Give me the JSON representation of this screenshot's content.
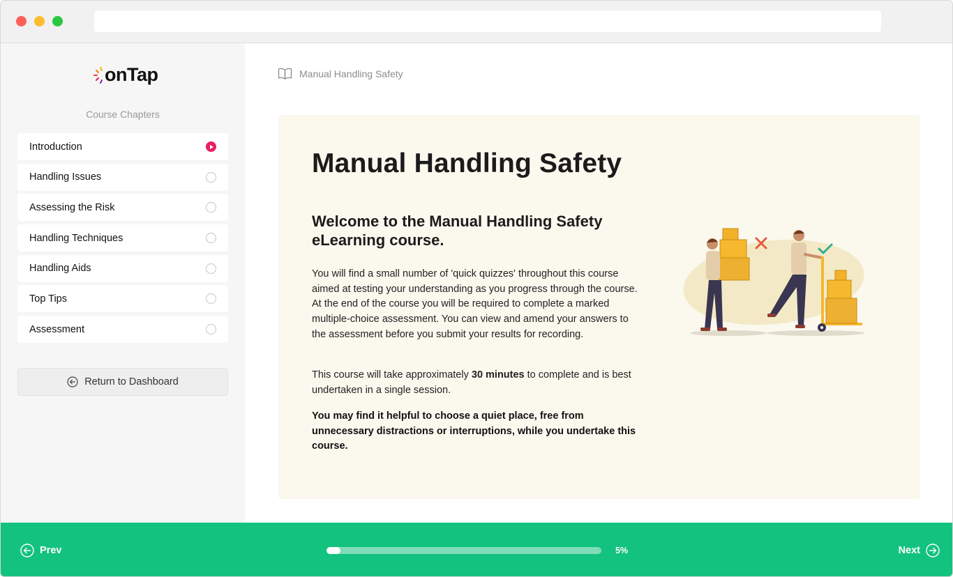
{
  "window": {
    "controls": [
      "close",
      "minimize",
      "maximize"
    ],
    "url": ""
  },
  "sidebar": {
    "logo_text": "onTap",
    "chapters_title": "Course Chapters",
    "chapters": [
      {
        "label": "Introduction",
        "status": "current"
      },
      {
        "label": "Handling Issues",
        "status": "not-started"
      },
      {
        "label": "Assessing the Risk",
        "status": "not-started"
      },
      {
        "label": "Handling Techniques",
        "status": "not-started"
      },
      {
        "label": "Handling Aids",
        "status": "not-started"
      },
      {
        "label": "Top Tips",
        "status": "not-started"
      },
      {
        "label": "Assessment",
        "status": "not-started"
      }
    ],
    "return_label": "Return to Dashboard"
  },
  "breadcrumb": {
    "icon": "book-icon",
    "label": "Manual Handling Safety"
  },
  "content": {
    "title": "Manual Handling Safety",
    "subtitle": "Welcome to the Manual Handling Safety eLearning course.",
    "paragraph_1": "You will find a small number of 'quick quizzes' throughout this course aimed at testing your understanding as you progress through the course.  At the end of the course you will be required to complete a marked multiple-choice assessment. You can view and amend your answers to the assessment before you submit your results for recording.",
    "paragraph_2_before": "This course will take approximately ",
    "paragraph_2_bold": "30 minutes",
    "paragraph_2_after": " to complete and is best undertaken in a single session.",
    "paragraph_3": "You may find it helpful to choose a quiet place, free from unnecessary distractions or interruptions, while you undertake this course."
  },
  "footer": {
    "prev_label": "Prev",
    "next_label": "Next",
    "progress_percent": 5,
    "progress_label": "5%"
  },
  "colors": {
    "accent_green": "#13c27e",
    "current_chapter": "#e91e63",
    "card_background": "#fbf8ee"
  }
}
